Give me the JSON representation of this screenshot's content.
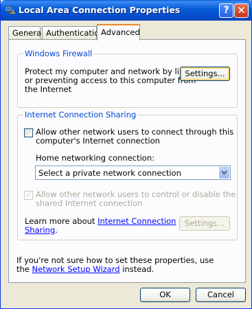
{
  "window": {
    "title": "Local Area Connection Properties",
    "help_label": "?",
    "close_label": "✕"
  },
  "tabs": [
    {
      "label": "General"
    },
    {
      "label": "Authentication"
    },
    {
      "label": "Advanced",
      "active": true
    }
  ],
  "firewall": {
    "group_title": "Windows Firewall",
    "description_1": "Protect my computer and network by limiting",
    "description_2": "or preventing access to this computer from",
    "description_3": "the Internet",
    "settings_button": "Settings..."
  },
  "ics": {
    "group_title": "Internet Connection Sharing",
    "allow_connect_1": "Allow other network users to connect through this",
    "allow_connect_2": "computer's Internet connection",
    "allow_connect_checked": false,
    "home_network_label": "Home networking connection:",
    "home_network_value": "Select a private network connection",
    "allow_control_1": "Allow other network users to control or disable the",
    "allow_control_2": "shared Internet connection",
    "allow_control_checked": true,
    "learn_more_prefix": "Learn more about ",
    "learn_more_link_1": "Internet Connection",
    "learn_more_link_2": "Sharing",
    "learn_more_suffix": ".",
    "settings_button": "Settings..."
  },
  "footer": {
    "note_1": "If you're not sure how to set these properties, use",
    "note_prefix": "the ",
    "wizard_link": "Network Setup Wizard",
    "note_suffix": " instead."
  },
  "buttons": {
    "ok": "OK",
    "cancel": "Cancel"
  }
}
